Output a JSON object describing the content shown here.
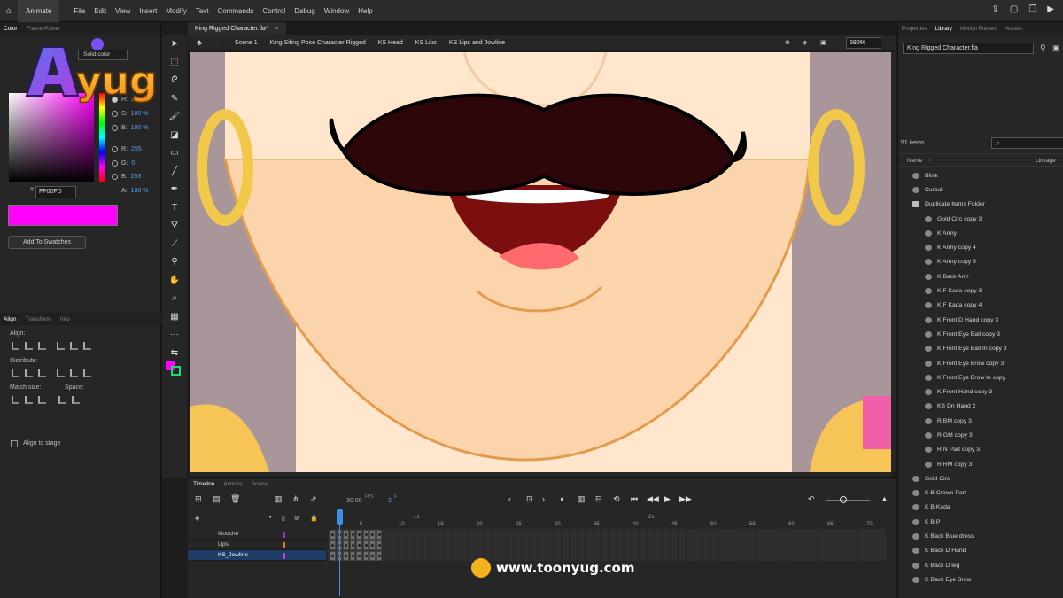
{
  "menubar": {
    "app": "Animate",
    "menus": [
      "File",
      "Edit",
      "View",
      "Insert",
      "Modify",
      "Text",
      "Commands",
      "Control",
      "Debug",
      "Window",
      "Help"
    ]
  },
  "left": {
    "tabs": [
      "Color",
      "Frame Picker"
    ],
    "fill_type": "Solid color",
    "hsb": [
      {
        "k": "H:",
        "v": "300 °"
      },
      {
        "k": "S:",
        "v": "100 %"
      },
      {
        "k": "B:",
        "v": "100 %"
      }
    ],
    "rgb": [
      {
        "k": "R:",
        "v": "255"
      },
      {
        "k": "G:",
        "v": "0"
      },
      {
        "k": "B:",
        "v": "253"
      }
    ],
    "alpha": {
      "k": "A:",
      "v": "100 %"
    },
    "hex_label": "#",
    "hex": "FF00FD",
    "add_swatches": "Add To Swatches",
    "swatch_color": "#ff00fd",
    "align_tabs": [
      "Align",
      "Transform",
      "Info"
    ],
    "align_label": "Align:",
    "distribute_label": "Distribute:",
    "match_label": "Match size:",
    "space_label": "Space:",
    "align_to_stage": "Align to stage"
  },
  "logo": {
    "text": "yug"
  },
  "document": {
    "tab": "King Rigged Character.fla*",
    "breadcrumbs": [
      "Scene 1",
      "King Siting Pose Character Rigged",
      "KS Head",
      "KS Lips",
      "KS Lips and Jowline"
    ],
    "zoom": "590%"
  },
  "right": {
    "tabs": [
      "Properties",
      "Library",
      "Motion Presets",
      "Assets"
    ],
    "file": "King Rigged Character.fla",
    "item_count": "91 items",
    "col_name": "Name",
    "col_linkage": "Linkage",
    "items": [
      {
        "name": "Blink",
        "indent": 0,
        "folder": false
      },
      {
        "name": "Curcul",
        "indent": 0,
        "folder": false
      },
      {
        "name": "Duplicate Items Folder",
        "indent": 0,
        "folder": true
      },
      {
        "name": "Gold Circ copy 3",
        "indent": 1,
        "folder": false
      },
      {
        "name": "K Army",
        "indent": 1,
        "folder": false
      },
      {
        "name": "K Army copy 4",
        "indent": 1,
        "folder": false
      },
      {
        "name": "K Army copy 5",
        "indent": 1,
        "folder": false
      },
      {
        "name": "K Back Arm",
        "indent": 1,
        "folder": false
      },
      {
        "name": "K F Kada copy 3",
        "indent": 1,
        "folder": false
      },
      {
        "name": "K F Kada copy 4",
        "indent": 1,
        "folder": false
      },
      {
        "name": "K Front D Hand copy 3",
        "indent": 1,
        "folder": false
      },
      {
        "name": "K Front Eye Ball copy 3",
        "indent": 1,
        "folder": false
      },
      {
        "name": "K Front Eye Ball In copy 3",
        "indent": 1,
        "folder": false
      },
      {
        "name": "K Front Eye Brow copy 3",
        "indent": 1,
        "folder": false
      },
      {
        "name": "K Front Eye Brow In copy",
        "indent": 1,
        "folder": false
      },
      {
        "name": "K Front Hand copy 3",
        "indent": 1,
        "folder": false
      },
      {
        "name": "KS Dn Hand 2",
        "indent": 1,
        "folder": false
      },
      {
        "name": "R BM copy 3",
        "indent": 1,
        "folder": false
      },
      {
        "name": "R GM copy 3",
        "indent": 1,
        "folder": false
      },
      {
        "name": "R N Part copy 3",
        "indent": 1,
        "folder": false
      },
      {
        "name": "R RM copy 3",
        "indent": 1,
        "folder": false
      },
      {
        "name": "Gold Circ",
        "indent": 0,
        "folder": false
      },
      {
        "name": "K B Crown Part",
        "indent": 0,
        "folder": false
      },
      {
        "name": "K B Kada",
        "indent": 0,
        "folder": false
      },
      {
        "name": "K B P",
        "indent": 0,
        "folder": false
      },
      {
        "name": "K Back Blue dress",
        "indent": 0,
        "folder": false
      },
      {
        "name": "K Back D Hand",
        "indent": 0,
        "folder": false
      },
      {
        "name": "K Back D leg",
        "indent": 0,
        "folder": false
      },
      {
        "name": "K Back Eye Brow",
        "indent": 0,
        "folder": false
      }
    ]
  },
  "timeline": {
    "tabs": [
      "Timeline",
      "Actions",
      "Scene"
    ],
    "fps": "30.00",
    "fps_unit": "FPS",
    "frame": "2",
    "frame_unit": "F",
    "ruler": [
      "1s",
      "5",
      "10",
      "15",
      "20",
      "25",
      "30",
      "35",
      "40",
      "45",
      "50",
      "55",
      "60",
      "65",
      "70",
      "2s"
    ],
    "layers": [
      {
        "name": "Mooche",
        "color": "#9b2fd6"
      },
      {
        "name": "Lips",
        "color": "#e07a1f"
      },
      {
        "name": "KS_Jowline",
        "color": "#c63cd0"
      }
    ]
  },
  "footer": {
    "url": "www.toonyug.com"
  }
}
